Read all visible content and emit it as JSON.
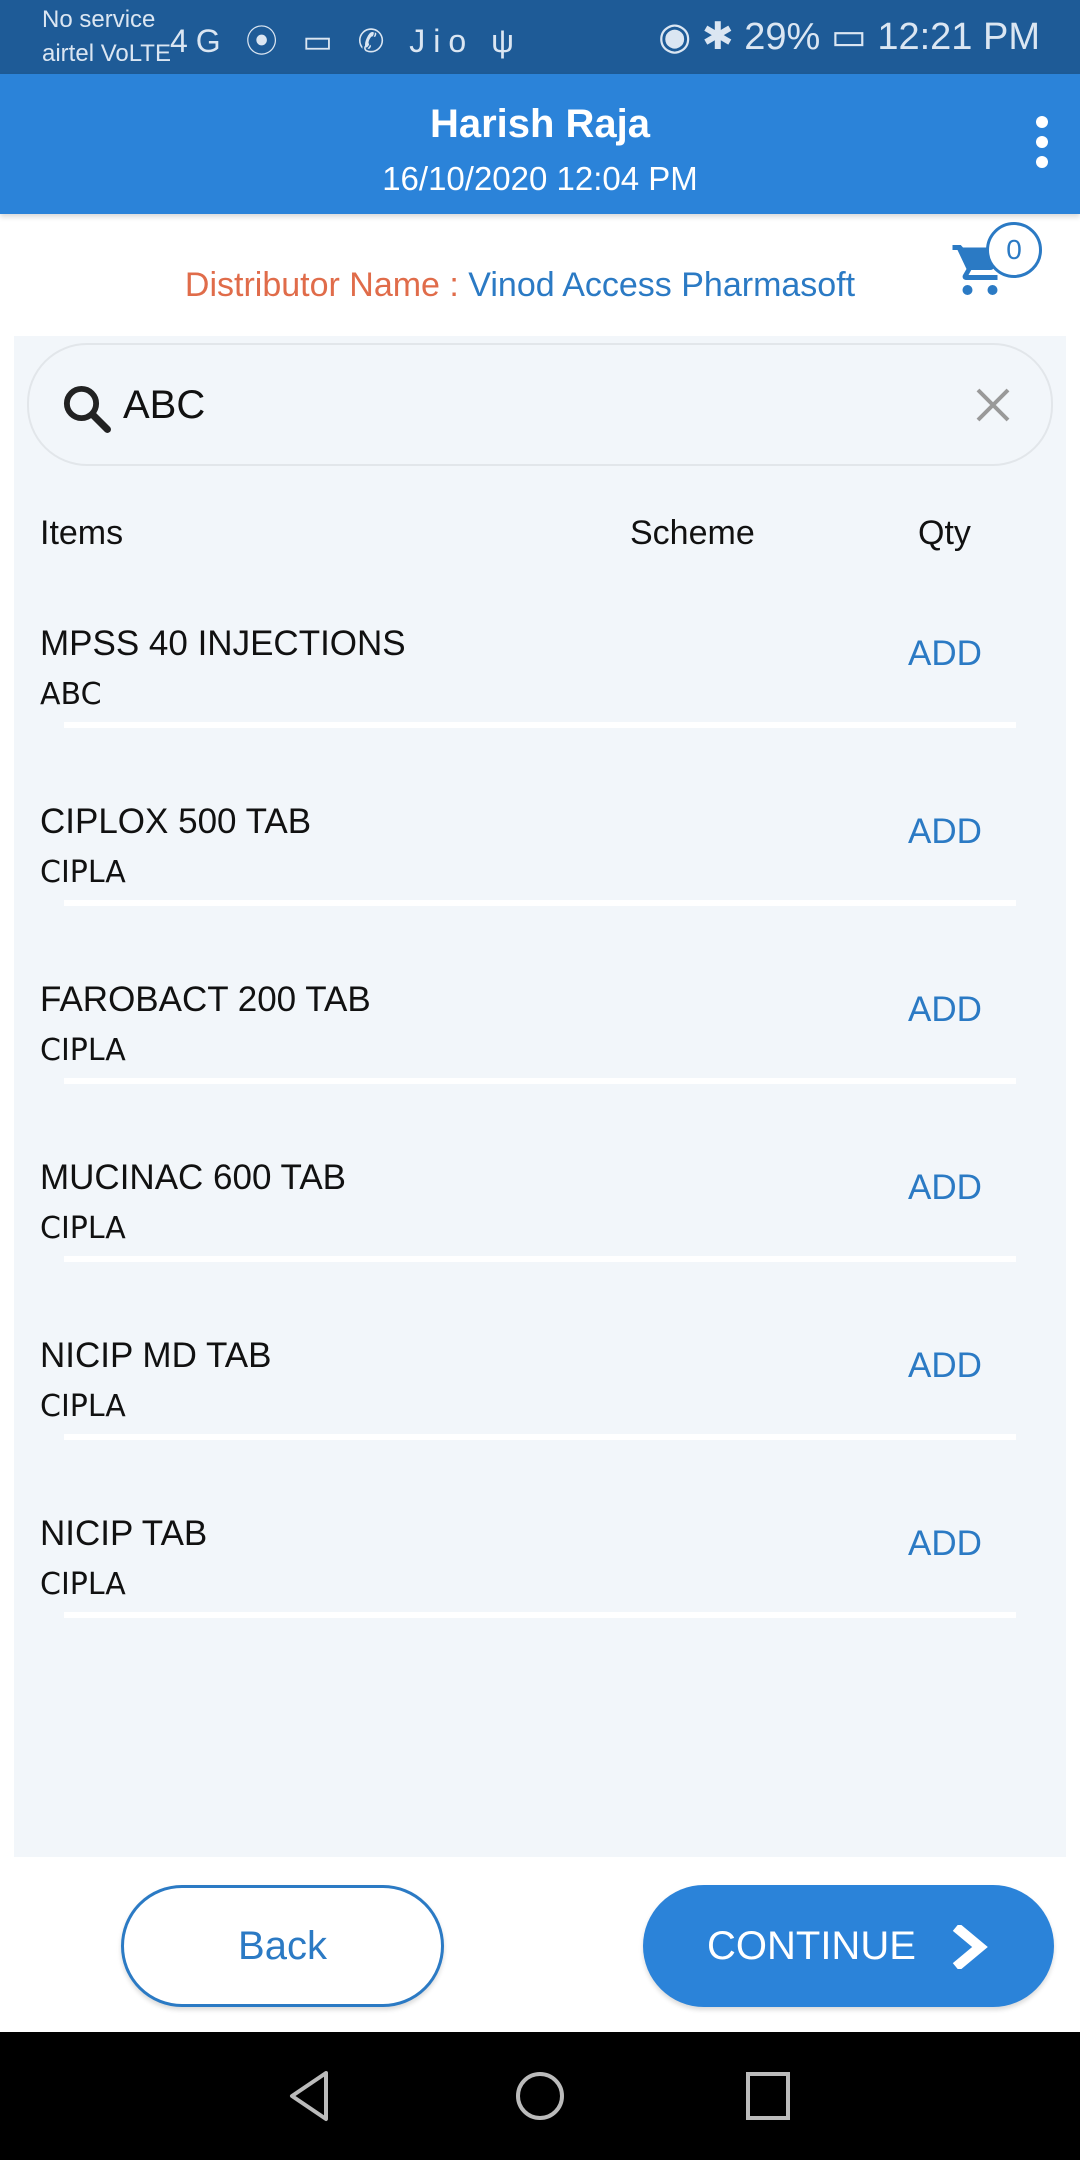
{
  "status_bar": {
    "carrier1": "No service",
    "carrier2": "airtel VoLTE",
    "icons": "4G ⦿ ▭ ✆ Jio ψ",
    "battery": "29%",
    "time": "12:21 PM"
  },
  "header": {
    "title": "Harish Raja",
    "datetime": "16/10/2020 12:04 PM"
  },
  "distributor": {
    "label": "Distributor Name : ",
    "value": "Vinod Access Pharmasoft"
  },
  "cart": {
    "count": "0"
  },
  "search": {
    "value": "ABC"
  },
  "columns": {
    "items": "Items",
    "scheme": "Scheme",
    "qty": "Qty"
  },
  "items": [
    {
      "name": "MPSS 40 INJECTIONS",
      "company": "ABC",
      "action": "ADD"
    },
    {
      "name": "CIPLOX 500 TAB",
      "company": "CIPLA",
      "action": "ADD"
    },
    {
      "name": "FAROBACT 200 TAB",
      "company": "CIPLA",
      "action": "ADD"
    },
    {
      "name": "MUCINAC 600 TAB",
      "company": "CIPLA",
      "action": "ADD"
    },
    {
      "name": "NICIP MD TAB",
      "company": "CIPLA",
      "action": "ADD"
    },
    {
      "name": "NICIP TAB",
      "company": "CIPLA",
      "action": "ADD"
    }
  ],
  "buttons": {
    "back": "Back",
    "continue": "CONTINUE"
  },
  "colors": {
    "header": "#2b83d9",
    "status": "#1e5b97",
    "accent": "#2b7ac4",
    "label": "#e06c4a"
  }
}
